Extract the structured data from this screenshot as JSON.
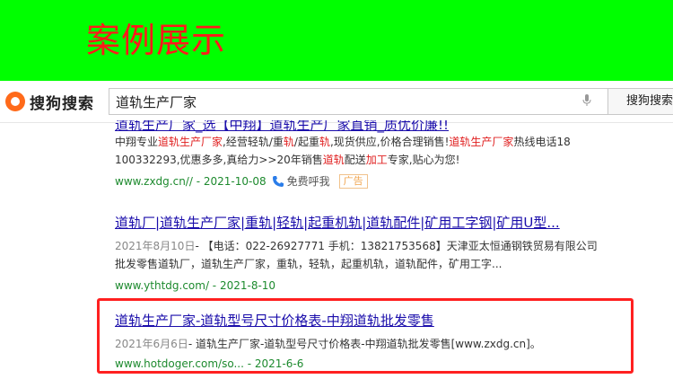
{
  "banner": {
    "title": "案例展示",
    "bg_color": "#00ff00",
    "title_color": "#ff1a1a"
  },
  "search": {
    "logo_text": "搜狗搜索",
    "query": "道轨生产厂家",
    "button_label": "搜狗搜索"
  },
  "results": [
    {
      "title": "道轨生产厂家_选【中翔】道轨生产厂家直销_质优价廉!!",
      "lines": [
        "中翔专业道轨生产厂家,经营轻轨/重轨/起重轨,现货供应,价格合理销售!道轨生产厂家热线电话18",
        "100332293,优惠多多,真给力>>20年销售道轨配送加工专家,贴心为您!"
      ],
      "url": "www.zxdg.cn// - 2021-10-08",
      "call_label": "免费呼我",
      "ad_label": "广告"
    },
    {
      "title": "道轨厂|道轨生产厂家|重轨|轻轨|起重机轨|道轨配件|矿用工字钢|矿用U型...",
      "date": "2021年8月10日",
      "line1_rest": "- 【电话：022-26927771 手机：13821753568】天津亚太恒通钢铁贸易有限公司",
      "line2": "批发零售道轨厂，道轨生产厂家，重轨，轻轨，起重机轨，道轨配件，矿用工字...",
      "url": "www.ythtdg.com/ - 2021-8-10"
    },
    {
      "title": "道轨生产厂家-道轨型号尺寸价格表-中翔道轨批发零售",
      "date": "2021年6月6日",
      "line1_rest": "- 道轨生产厂家-道轨型号尺寸价格表-中翔道轨批发零售[www.zxdg.cn]。",
      "url": "www.hotdoger.com/so... - 2021-6-6"
    }
  ]
}
